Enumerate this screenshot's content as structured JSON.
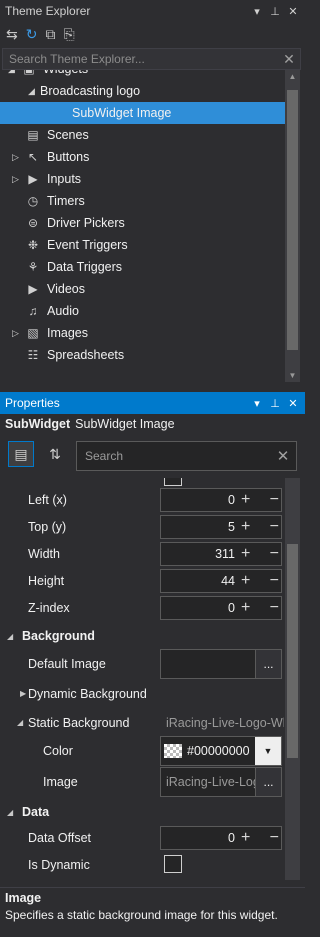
{
  "theme_explorer": {
    "title": "Theme Explorer",
    "search_placeholder": "Search Theme Explorer...",
    "tree": [
      {
        "label": "Widgets",
        "icon": "widgets-icon",
        "glyph": "▣",
        "expander": "◢",
        "indent": 22,
        "selected": false
      },
      {
        "label": "Broadcasting logo",
        "icon": "",
        "glyph": "",
        "expander": "◢",
        "indent": 42,
        "selected": false
      },
      {
        "label": "SubWidget Image",
        "icon": "",
        "glyph": "",
        "expander": "",
        "indent": 74,
        "selected": true
      },
      {
        "label": "Scenes",
        "icon": "scenes-icon",
        "glyph": "▤",
        "expander": "",
        "indent": 26,
        "selected": false
      },
      {
        "label": "Buttons",
        "icon": "pointer-icon",
        "glyph": "↖",
        "expander": "▷",
        "indent": 26,
        "selected": false
      },
      {
        "label": "Inputs",
        "icon": "input-icon",
        "glyph": "▶",
        "expander": "▷",
        "indent": 26,
        "selected": false
      },
      {
        "label": "Timers",
        "icon": "clock-icon",
        "glyph": "◷",
        "expander": "",
        "indent": 26,
        "selected": false
      },
      {
        "label": "Driver Pickers",
        "icon": "steering-wheel-icon",
        "glyph": "⊜",
        "expander": "",
        "indent": 26,
        "selected": false
      },
      {
        "label": "Event Triggers",
        "icon": "event-trigger-icon",
        "glyph": "❉",
        "expander": "",
        "indent": 26,
        "selected": false
      },
      {
        "label": "Data Triggers",
        "icon": "lightbulb-icon",
        "glyph": "⚘",
        "expander": "",
        "indent": 26,
        "selected": false
      },
      {
        "label": "Videos",
        "icon": "video-icon",
        "glyph": "▶",
        "expander": "",
        "indent": 26,
        "selected": false
      },
      {
        "label": "Audio",
        "icon": "speaker-icon",
        "glyph": "♫",
        "expander": "",
        "indent": 26,
        "selected": false
      },
      {
        "label": "Images",
        "icon": "images-icon",
        "glyph": "▧",
        "expander": "▷",
        "indent": 26,
        "selected": false
      },
      {
        "label": "Spreadsheets",
        "icon": "spreadsheet-icon",
        "glyph": "☷",
        "expander": "",
        "indent": 26,
        "selected": false
      }
    ]
  },
  "properties": {
    "title": "Properties",
    "object_type": "SubWidget",
    "object_name": "SubWidget Image",
    "search_placeholder": "Search",
    "rows": {
      "left_label": "Left (x)",
      "left_value": "0",
      "top_label": "Top (y)",
      "top_value": "5",
      "width_label": "Width",
      "width_value": "311",
      "height_label": "Height",
      "height_value": "44",
      "zindex_label": "Z-index",
      "zindex_value": "0"
    },
    "background": {
      "category": "Background",
      "default_image_label": "Default Image",
      "dynamic_background_label": "Dynamic Background",
      "static_background_label": "Static Background",
      "static_background_value": "iRacing-Live-Logo-Wh",
      "color_label": "Color",
      "color_value": "#00000000",
      "image_label": "Image",
      "image_value": "iRacing-Live-Logo"
    },
    "data": {
      "category": "Data",
      "data_offset_label": "Data Offset",
      "data_offset_value": "0",
      "is_dynamic_label": "Is Dynamic"
    },
    "ellipsis": "...",
    "help_title": "Image",
    "help_description": "Specifies a static background image for this widget."
  },
  "colors": {
    "accent": "#007acc",
    "selection": "#2f8ed8",
    "panel_bg": "#2d2d30"
  }
}
